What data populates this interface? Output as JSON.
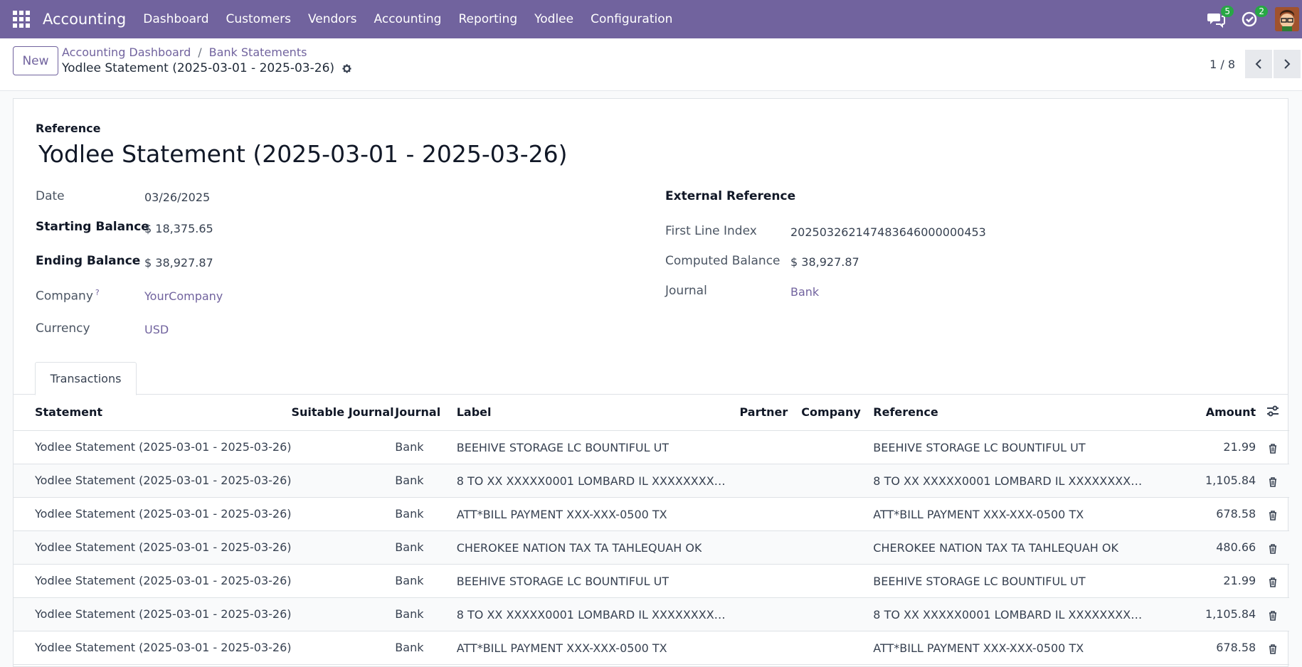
{
  "navbar": {
    "brand": "Accounting",
    "menu": [
      "Dashboard",
      "Customers",
      "Vendors",
      "Accounting",
      "Reporting",
      "Yodlee",
      "Configuration"
    ],
    "messages_count": "5",
    "activities_count": "2",
    "color": "#71639e"
  },
  "control": {
    "new_label": "New",
    "breadcrumb": [
      "Accounting Dashboard",
      "Bank Statements"
    ],
    "record_title": "Yodlee Statement (2025-03-01 - 2025-03-26)",
    "pager": "1 / 8"
  },
  "form": {
    "reference_label": "Reference",
    "reference_value": "Yodlee Statement (2025-03-01 - 2025-03-26)",
    "date_label": "Date",
    "date_value": "03/26/2025",
    "starting_balance_label": "Starting Balance",
    "starting_balance_value": "$ 18,375.65",
    "ending_balance_label": "Ending Balance",
    "ending_balance_value": "$ 38,927.87",
    "company_label": "Company",
    "company_tip": "?",
    "company_value": "YourCompany",
    "currency_label": "Currency",
    "currency_value": "USD",
    "external_reference_label": "External Reference",
    "first_line_index_label": "First Line Index",
    "first_line_index_value": "202503262147483646000000453",
    "computed_balance_label": "Computed Balance",
    "computed_balance_value": "$ 38,927.87",
    "journal_label": "Journal",
    "journal_value": "Bank"
  },
  "tabs": [
    "Transactions"
  ],
  "table": {
    "columns": [
      "Statement",
      "Suitable Journal",
      "Journal",
      "Label",
      "Partner",
      "Company",
      "Reference",
      "Amount"
    ],
    "rows": [
      {
        "statement": "Yodlee Statement (2025-03-01 - 2025-03-26)",
        "suitable": "",
        "journal": "Bank",
        "label": "BEEHIVE STORAGE LC BOUNTIFUL UT",
        "partner": "",
        "company": "",
        "reference": "BEEHIVE STORAGE LC BOUNTIFUL UT",
        "amount": "21.99"
      },
      {
        "statement": "Yodlee Statement (2025-03-01 - 2025-03-26)",
        "suitable": "",
        "journal": "Bank",
        "label": "8 TO XX XXXXX0001 LOMBARD IL XXXXXXXX…",
        "partner": "",
        "company": "",
        "reference": "8 TO XX XXXXX0001 LOMBARD IL XXXXXXXX…",
        "amount": "1,105.84"
      },
      {
        "statement": "Yodlee Statement (2025-03-01 - 2025-03-26)",
        "suitable": "",
        "journal": "Bank",
        "label": "ATT*BILL PAYMENT XXX-XXX-0500 TX",
        "partner": "",
        "company": "",
        "reference": "ATT*BILL PAYMENT XXX-XXX-0500 TX",
        "amount": "678.58"
      },
      {
        "statement": "Yodlee Statement (2025-03-01 - 2025-03-26)",
        "suitable": "",
        "journal": "Bank",
        "label": "CHEROKEE NATION TAX TA TAHLEQUAH OK",
        "partner": "",
        "company": "",
        "reference": "CHEROKEE NATION TAX TA TAHLEQUAH OK",
        "amount": "480.66"
      },
      {
        "statement": "Yodlee Statement (2025-03-01 - 2025-03-26)",
        "suitable": "",
        "journal": "Bank",
        "label": "BEEHIVE STORAGE LC BOUNTIFUL UT",
        "partner": "",
        "company": "",
        "reference": "BEEHIVE STORAGE LC BOUNTIFUL UT",
        "amount": "21.99"
      },
      {
        "statement": "Yodlee Statement (2025-03-01 - 2025-03-26)",
        "suitable": "",
        "journal": "Bank",
        "label": "8 TO XX XXXXX0001 LOMBARD IL XXXXXXXX…",
        "partner": "",
        "company": "",
        "reference": "8 TO XX XXXXX0001 LOMBARD IL XXXXXXXX…",
        "amount": "1,105.84"
      },
      {
        "statement": "Yodlee Statement (2025-03-01 - 2025-03-26)",
        "suitable": "",
        "journal": "Bank",
        "label": "ATT*BILL PAYMENT XXX-XXX-0500 TX",
        "partner": "",
        "company": "",
        "reference": "ATT*BILL PAYMENT XXX-XXX-0500 TX",
        "amount": "678.58"
      }
    ]
  }
}
